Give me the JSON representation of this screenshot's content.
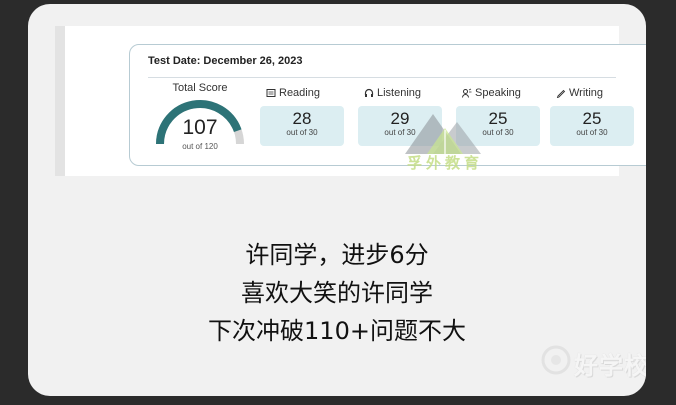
{
  "score_report": {
    "test_date": "Test Date: December 26, 2023",
    "total": {
      "label": "Total Score",
      "value": "107",
      "out_of": "out of 120",
      "fraction": 0.892
    },
    "sections": [
      {
        "name": "Reading",
        "icon": "book-icon",
        "value": "28",
        "out_of": "out of 30"
      },
      {
        "name": "Listening",
        "icon": "headphones-icon",
        "value": "29",
        "out_of": "out of 30"
      },
      {
        "name": "Speaking",
        "icon": "speaking-icon",
        "value": "25",
        "out_of": "out of 30"
      },
      {
        "name": "Writing",
        "icon": "pencil-icon",
        "value": "25",
        "out_of": "out of 30"
      }
    ],
    "watermark_text": "孚外教育"
  },
  "caption": {
    "line1": "许同学，进步6分",
    "line2": "喜欢大笑的许同学",
    "line3": "下次冲破110+问题不大"
  },
  "site_watermark": {
    "name": "好学校"
  },
  "colors": {
    "gauge": "#2d7377",
    "gauge_track": "#d6d6d6",
    "section_box": "#dceef2",
    "panel_border": "#b7cbd3"
  }
}
